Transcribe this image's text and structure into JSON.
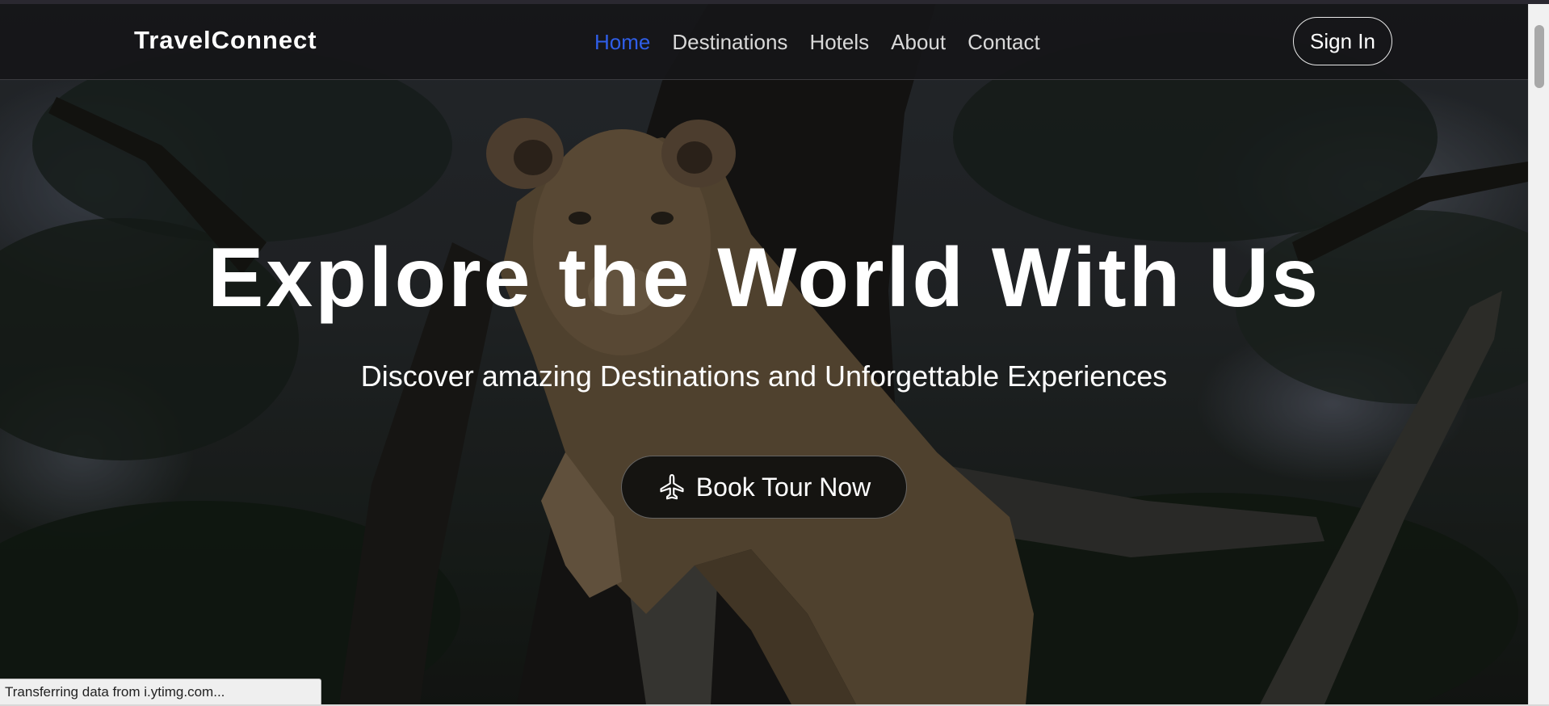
{
  "navbar": {
    "brand": "TravelConnect",
    "links": [
      {
        "label": "Home",
        "active": true
      },
      {
        "label": "Destinations",
        "active": false
      },
      {
        "label": "Hotels",
        "active": false
      },
      {
        "label": "About",
        "active": false
      },
      {
        "label": "Contact",
        "active": false
      }
    ],
    "signin_label": "Sign In"
  },
  "hero": {
    "title": "Explore the World With Us",
    "subtitle": "Discover amazing Destinations and Unforgettable Experiences",
    "cta_label": "Book Tour Now",
    "cta_icon": "airplane-icon",
    "background_image": "lioness-in-tree-photo"
  },
  "status_bar": {
    "text": "Transferring data from i.ytimg.com..."
  },
  "colors": {
    "active_link": "#2f5ee8",
    "nav_text": "#d9d9d9",
    "navbar_bg": "#161618",
    "cta_bg": "#0e0e0e",
    "text_white": "#ffffff"
  }
}
